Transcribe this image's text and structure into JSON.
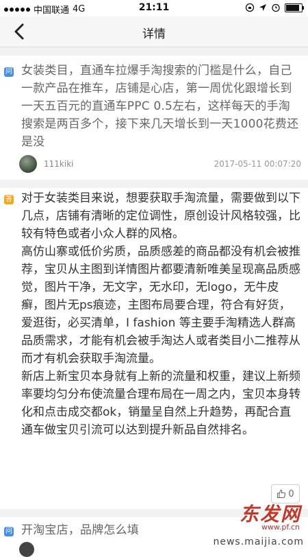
{
  "status_bar": {
    "carrier": "中国联通",
    "network": "4G",
    "time": "21:11"
  },
  "nav": {
    "title": "详情"
  },
  "question": {
    "badge": "问",
    "text": "女装类目，直通车拉爆手淘搜索的门槛是什么，自己一款产品在推车，店铺是心店，第一周优化跟增长到一天五百元的直通车PPC 0.5左右，这样每天的手淘搜索是两百多个，接下来几天增长到一天1000花费还是没",
    "author": "111kiki",
    "time": "2017-05-11 00:07:20"
  },
  "answer": {
    "badge": "答",
    "paragraphs": [
      "对于女装类目来说，想要获取手淘流量，需要做到以下几点，店铺有清晰的定位调性，原创设计风格较强，比较有特色或者小众人群的风格。",
      "高仿山寨或低价劣质，品质感差的商品都没有机会被推荐，宝贝从主图到详情图片都要清新唯美呈现高品质感觉，图片干净，无文字，无水印，无logo，无牛皮癣，图片无ps痕迹，主图布局要合理，符合有好货，爱逛街，必买清单，I fashion 等主要手淘精选人群高品质需求，才能有机会被手淘达人或者类目小二推荐从而才有机会获取手淘流量。",
      "新店上新宝贝本身就有上新的流量和权重，建议上新频率要均匀分布使流量合理布局在一周之内，宝贝本身转化和点击成交都ok，销量呈自然上升趋势，再配合直通车做宝贝引流可以达到提升新品自然排名。"
    ],
    "like_count": "0"
  },
  "next_question": {
    "badge": "问",
    "text": "开淘宝店，品牌怎么填"
  },
  "watermark": {
    "brand": "东发网",
    "site": "www.pf.cn",
    "url": "news.maijia.com"
  }
}
